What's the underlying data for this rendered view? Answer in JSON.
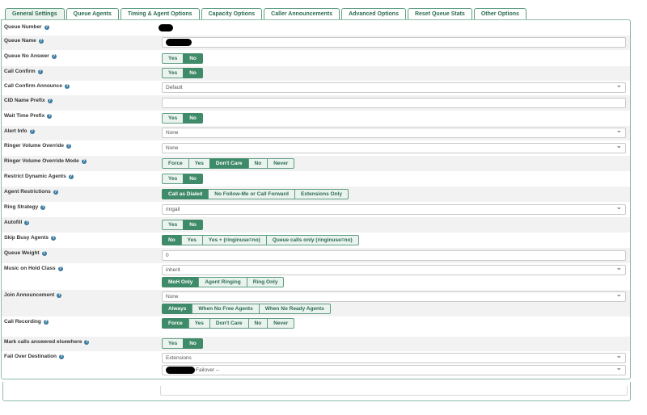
{
  "tabs": [
    {
      "label": "General Settings",
      "active": true
    },
    {
      "label": "Queue Agents"
    },
    {
      "label": "Timing & Agent Options"
    },
    {
      "label": "Capacity Options"
    },
    {
      "label": "Caller Announcements"
    },
    {
      "label": "Advanced Options"
    },
    {
      "label": "Reset Queue Stats"
    },
    {
      "label": "Other Options"
    }
  ],
  "fields": {
    "queue_number": {
      "label": "Queue Number"
    },
    "queue_name": {
      "label": "Queue Name"
    },
    "queue_no_answer": {
      "label": "Queue No Answer",
      "options": [
        "Yes",
        "No"
      ],
      "selected": "No"
    },
    "call_confirm": {
      "label": "Call Confirm",
      "options": [
        "Yes",
        "No"
      ],
      "selected": "No"
    },
    "call_confirm_announce": {
      "label": "Call Confirm Announce",
      "value": "Default"
    },
    "cid_name_prefix": {
      "label": "CID Name Prefix",
      "value": ""
    },
    "wait_time_prefix": {
      "label": "Wait Time Prefix",
      "options": [
        "Yes",
        "No"
      ],
      "selected": "No"
    },
    "alert_info": {
      "label": "Alert Info",
      "value": "None"
    },
    "ringer_volume_override": {
      "label": "Ringer Volume Override",
      "value": "None"
    },
    "ringer_volume_override_mode": {
      "label": "Ringer Volume Override Mode",
      "options": [
        "Force",
        "Yes",
        "Don't Care",
        "No",
        "Never"
      ],
      "selected": "Don't Care"
    },
    "restrict_dynamic_agents": {
      "label": "Restrict Dynamic Agents",
      "options": [
        "Yes",
        "No"
      ],
      "selected": "No"
    },
    "agent_restrictions": {
      "label": "Agent Restrictions",
      "options": [
        "Call as Dialed",
        "No Follow-Me or Call Forward",
        "Extensions Only"
      ],
      "selected": "Call as Dialed"
    },
    "ring_strategy": {
      "label": "Ring Strategy",
      "value": "ringall"
    },
    "autofill": {
      "label": "Autofill",
      "options": [
        "Yes",
        "No"
      ],
      "selected": "No"
    },
    "skip_busy_agents": {
      "label": "Skip Busy Agents",
      "options": [
        "No",
        "Yes",
        "Yes + (ringinuse=no)",
        "Queue calls only (ringinuse=no)"
      ],
      "selected": "No"
    },
    "queue_weight": {
      "label": "Queue Weight",
      "value": "0"
    },
    "music_on_hold_class": {
      "label": "Music on Hold Class",
      "value": "inherit",
      "options": [
        "MoH Only",
        "Agent Ringing",
        "Ring Only"
      ],
      "selected": "MoH Only"
    },
    "join_announcement": {
      "label": "Join Announcement",
      "value": "None",
      "options": [
        "Always",
        "When No Free Agents",
        "When No Ready Agents"
      ],
      "selected": "Always"
    },
    "call_recording": {
      "label": "Call Recording",
      "options": [
        "Force",
        "Yes",
        "Don't Care",
        "No",
        "Never"
      ],
      "selected": "Force"
    },
    "mark_calls_answered_elsewhere": {
      "label": "Mark calls answered elsewhere",
      "options": [
        "Yes",
        "No"
      ],
      "selected": "No"
    },
    "fail_over_destination": {
      "label": "Fail Over Destination",
      "value": "Extensions",
      "value2_suffix": "Failover --"
    }
  },
  "icons": {
    "help": "help-circle-icon",
    "dropdown": "chevron-down-icon"
  },
  "colors": {
    "accent": "#3f8a68",
    "accent_light": "#eaf3ee",
    "border": "#5e9e83",
    "help": "#3b7a9e"
  }
}
